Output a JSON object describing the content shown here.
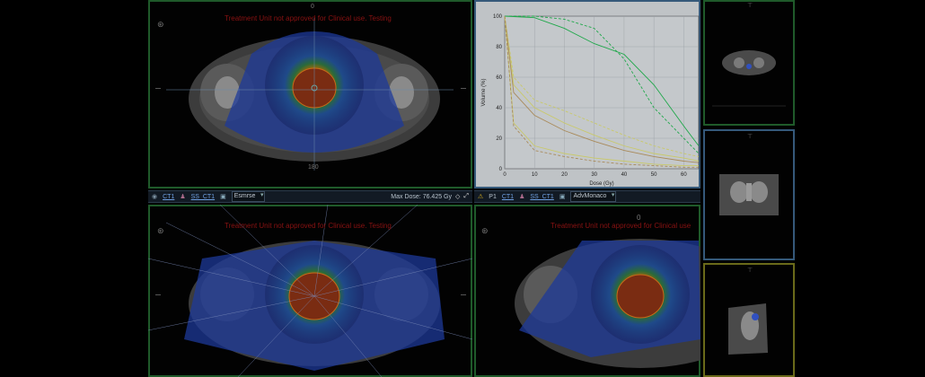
{
  "banner": {
    "top_left_warning": "Treatment Unit not approved for Clinical use. Testing",
    "bottom_left_warning": "Treatment Unit not approved for Clinical use. Testing",
    "bottom_right_warning": "Treatment Unit not approved for Clinical use"
  },
  "viewport_labels": {
    "top_left_bottom": "180",
    "top_left_top": "0",
    "bottom_right_top": "0"
  },
  "toolbar_left": {
    "ct_label": "CT1",
    "ss_label": "SS_CT1",
    "plan": "Esmrse",
    "max_dose": "Max Dose: 76.425 Gy"
  },
  "toolbar_right": {
    "p_label": "P1",
    "ct_label": "CT1",
    "ss_label": "SS_CT1",
    "plan": "AdvMonaco"
  },
  "chart_data": {
    "type": "line",
    "xlabel": "Dose (Gy)",
    "ylabel": "Volume (%)",
    "xlim": [
      0,
      65
    ],
    "ylim": [
      0,
      100
    ],
    "xticks": [
      "0",
      "10",
      "20",
      "30",
      "40",
      "50",
      "60"
    ],
    "yticks": [
      "0",
      "20",
      "40",
      "60",
      "80",
      "100"
    ],
    "grid": true,
    "series": [
      {
        "color": "#1fa84a",
        "style": "solid",
        "x": [
          0,
          10,
          20,
          30,
          40,
          50,
          60,
          65
        ],
        "y": [
          100,
          99,
          92,
          82,
          75,
          55,
          28,
          15
        ]
      },
      {
        "color": "#1fa84a",
        "style": "dashed",
        "x": [
          0,
          10,
          20,
          30,
          40,
          50,
          60,
          65
        ],
        "y": [
          100,
          100,
          98,
          92,
          72,
          40,
          20,
          10
        ]
      },
      {
        "color": "#c9c96a",
        "style": "solid",
        "x": [
          0,
          3,
          10,
          20,
          30,
          40,
          50,
          60,
          65
        ],
        "y": [
          100,
          55,
          40,
          30,
          22,
          15,
          10,
          7,
          5
        ]
      },
      {
        "color": "#c9c96a",
        "style": "dashed",
        "x": [
          0,
          3,
          10,
          20,
          30,
          40,
          50,
          60,
          65
        ],
        "y": [
          100,
          60,
          45,
          38,
          30,
          22,
          15,
          10,
          8
        ]
      },
      {
        "color": "#a98a5a",
        "style": "solid",
        "x": [
          0,
          3,
          10,
          20,
          30,
          40,
          50,
          60,
          65
        ],
        "y": [
          100,
          50,
          35,
          25,
          18,
          12,
          8,
          5,
          4
        ]
      },
      {
        "color": "#c9c96a",
        "style": "solid",
        "x": [
          0,
          3,
          10,
          20,
          30,
          40,
          50,
          60,
          65
        ],
        "y": [
          100,
          30,
          15,
          10,
          7,
          5,
          3,
          2,
          2
        ]
      },
      {
        "color": "#a98a5a",
        "style": "dashed",
        "x": [
          0,
          3,
          10,
          20,
          30,
          40,
          50,
          60,
          65
        ],
        "y": [
          100,
          28,
          12,
          8,
          5,
          3,
          2,
          1,
          1
        ]
      }
    ]
  }
}
